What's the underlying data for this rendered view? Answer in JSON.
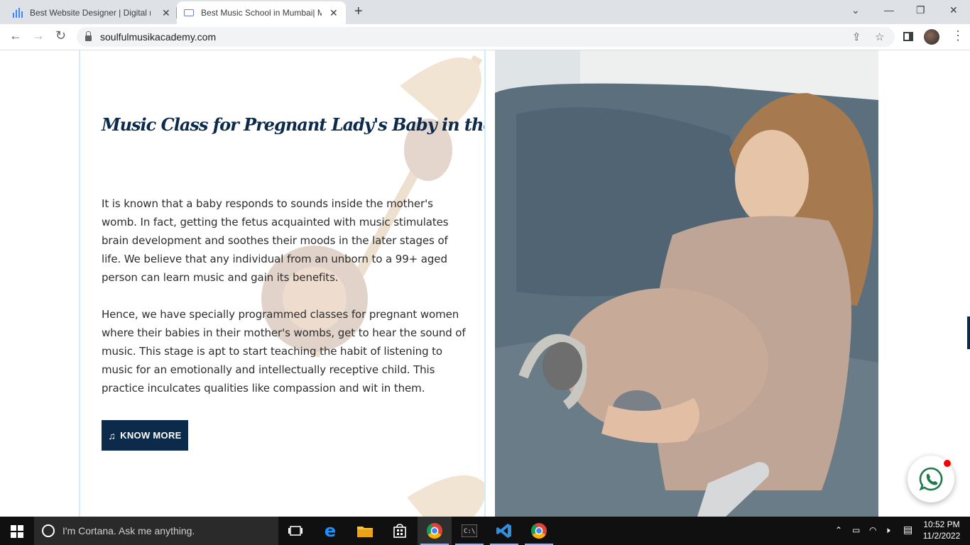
{
  "browser": {
    "tabs": [
      {
        "title": "Best Website Designer | Digital m",
        "favicon": "bar-chart-icon",
        "active": false
      },
      {
        "title": "Best Music School in Mumbai| M",
        "favicon": "site-logo-icon",
        "active": true
      }
    ],
    "url": "soulfulmusikacademy.com"
  },
  "page": {
    "heading": "Music Class for Pregnant Lady's Baby in the Womb",
    "paragraph1": "It is known that a baby responds to sounds inside the mother's womb. In fact, getting the fetus acquainted with music stimulates brain development and soothes their moods in the later stages of life. We believe that any individual from an unborn to a 99+ aged person can learn music and gain its benefits.",
    "paragraph2": "Hence, we have specially programmed classes for pregnant women where their babies in their mother's wombs, get to hear the sound of music. This stage is apt to start teaching the habit of listening to music for an emotionally and intellectually receptive child. This practice inculcates qualities like compassion and wit in them.",
    "cta_label": "KNOW MORE",
    "cta_icon": "music-note-icon",
    "accent_color": "#0c2a4a",
    "whatsapp_icon": "whatsapp-icon"
  },
  "taskbar": {
    "search_placeholder": "I'm Cortana. Ask me anything.",
    "time": "10:52 PM",
    "date": "11/2/2022"
  }
}
